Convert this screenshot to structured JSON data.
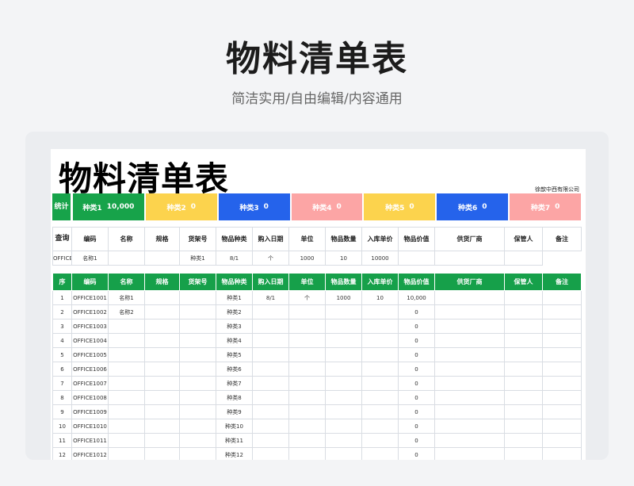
{
  "hero": {
    "title": "物料清单表",
    "subtitle": "简洁实用/自由编辑/内容通用"
  },
  "sheet": {
    "title": "物料清单表",
    "company": "徐歆中西有限公司"
  },
  "stats": {
    "label": "统计",
    "items": [
      {
        "name": "种类1",
        "value": "10,000",
        "color": "#17a34a"
      },
      {
        "name": "种类2",
        "value": "0",
        "color": "#fcd34d"
      },
      {
        "name": "种类3",
        "value": "0",
        "color": "#2563eb"
      },
      {
        "name": "种类4",
        "value": "0",
        "color": "#fca5a5"
      },
      {
        "name": "种类5",
        "value": "0",
        "color": "#fcd34d"
      },
      {
        "name": "种类6",
        "value": "0",
        "color": "#2563eb"
      },
      {
        "name": "种类7",
        "value": "0",
        "color": "#fca5a5"
      }
    ]
  },
  "query": {
    "label": "查询",
    "headers": [
      "编码",
      "名称",
      "规格",
      "货架号",
      "物品种类",
      "购入日期",
      "单位",
      "物品数量",
      "入库单价",
      "物品价值",
      "供货厂商",
      "保管人",
      "备注"
    ],
    "row": [
      "OFFICE1001",
      "名称1",
      "",
      "",
      "种类1",
      "8/1",
      "个",
      "1000",
      "10",
      "10000",
      "",
      "",
      ""
    ]
  },
  "details": {
    "headers": [
      "序",
      "编码",
      "名称",
      "规格",
      "货架号",
      "物品种类",
      "购入日期",
      "单位",
      "物品数量",
      "入库单价",
      "物品价值",
      "供货厂商",
      "保管人",
      "备注"
    ],
    "rows": [
      [
        "1",
        "OFFICE1001",
        "名称1",
        "",
        "",
        "种类1",
        "8/1",
        "个",
        "1000",
        "10",
        "10,000",
        "",
        "",
        ""
      ],
      [
        "2",
        "OFFICE1002",
        "名称2",
        "",
        "",
        "种类2",
        "",
        "",
        "",
        "",
        "0",
        "",
        "",
        ""
      ],
      [
        "3",
        "OFFICE1003",
        "",
        "",
        "",
        "种类3",
        "",
        "",
        "",
        "",
        "0",
        "",
        "",
        ""
      ],
      [
        "4",
        "OFFICE1004",
        "",
        "",
        "",
        "种类4",
        "",
        "",
        "",
        "",
        "0",
        "",
        "",
        ""
      ],
      [
        "5",
        "OFFICE1005",
        "",
        "",
        "",
        "种类5",
        "",
        "",
        "",
        "",
        "0",
        "",
        "",
        ""
      ],
      [
        "6",
        "OFFICE1006",
        "",
        "",
        "",
        "种类6",
        "",
        "",
        "",
        "",
        "0",
        "",
        "",
        ""
      ],
      [
        "7",
        "OFFICE1007",
        "",
        "",
        "",
        "种类7",
        "",
        "",
        "",
        "",
        "0",
        "",
        "",
        ""
      ],
      [
        "8",
        "OFFICE1008",
        "",
        "",
        "",
        "种类8",
        "",
        "",
        "",
        "",
        "0",
        "",
        "",
        ""
      ],
      [
        "9",
        "OFFICE1009",
        "",
        "",
        "",
        "种类9",
        "",
        "",
        "",
        "",
        "0",
        "",
        "",
        ""
      ],
      [
        "10",
        "OFFICE1010",
        "",
        "",
        "",
        "种类10",
        "",
        "",
        "",
        "",
        "0",
        "",
        "",
        ""
      ],
      [
        "11",
        "OFFICE1011",
        "",
        "",
        "",
        "种类11",
        "",
        "",
        "",
        "",
        "0",
        "",
        "",
        ""
      ],
      [
        "12",
        "OFFICE1012",
        "",
        "",
        "",
        "种类12",
        "",
        "",
        "",
        "",
        "0",
        "",
        "",
        ""
      ]
    ]
  }
}
